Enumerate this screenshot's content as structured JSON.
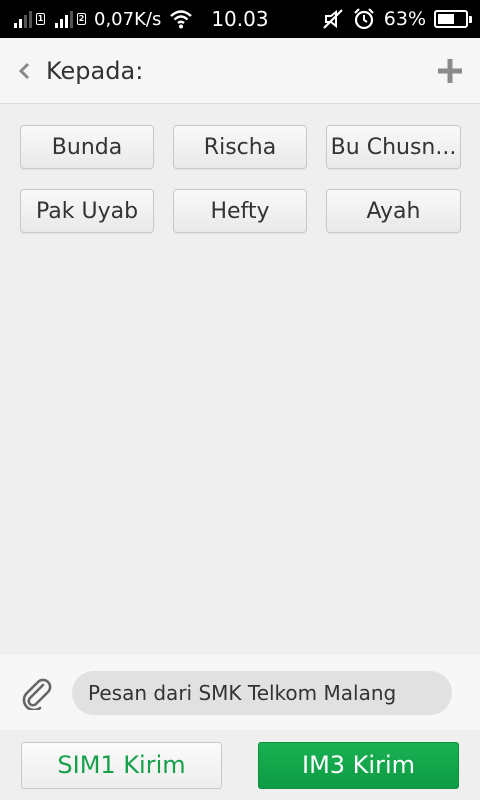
{
  "status_bar": {
    "sim1_label": "1",
    "sim2_label": "2",
    "network_speed": "0,07K/s",
    "time": "10.03",
    "battery_percent": "63%",
    "battery_level": 0.63,
    "icons": [
      "signal-icon",
      "wifi-icon",
      "muted-icon",
      "alarm-icon",
      "battery-icon"
    ]
  },
  "header": {
    "title": "Kepada:",
    "back_icon": "chevron-left-icon",
    "add_icon": "plus-icon"
  },
  "recipients": [
    {
      "label": "Bunda"
    },
    {
      "label": "Rischa"
    },
    {
      "label": "Bu Chusn..."
    },
    {
      "label": "Pak Uyab"
    },
    {
      "label": "Hefty"
    },
    {
      "label": "Ayah"
    }
  ],
  "compose": {
    "attach_icon": "paperclip-icon",
    "message_value": "Pesan dari SMK Telkom Malang"
  },
  "send": {
    "sim1_label": "SIM1 Kirim",
    "im3_label": "IM3 Kirim"
  },
  "colors": {
    "accent_green": "#17a04a",
    "primary_button": "#0e9b44",
    "background": "#efefef"
  }
}
